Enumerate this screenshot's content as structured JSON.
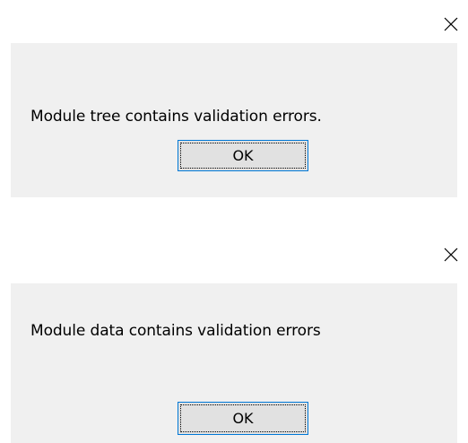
{
  "dialogs": [
    {
      "message": "Module tree contains validation errors.",
      "ok_label": "OK",
      "close_icon": "close-icon"
    },
    {
      "message": "Module data contains validation errors",
      "ok_label": "OK",
      "close_icon": "close-icon"
    }
  ],
  "colors": {
    "dialog_background": "#f0f0f0",
    "button_background": "#e1e1e1",
    "button_focus_border": "#0078d7"
  }
}
